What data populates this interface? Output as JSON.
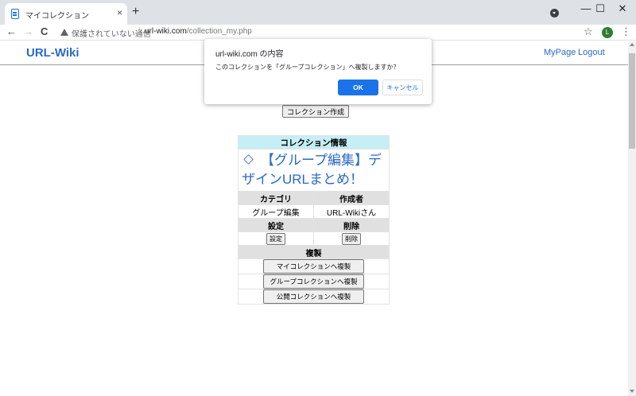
{
  "browser": {
    "tab_title": "マイコレクション",
    "tab_close": "×",
    "new_tab": "+",
    "back": "←",
    "forward": "→",
    "reload": "C",
    "security_text": "保護されていない通信",
    "url_separator": "|",
    "url_domain": "url-wiki.com",
    "url_path": "/collection_my.php",
    "star": "☆",
    "avatar_letter": "L",
    "menu": "⋮",
    "minimize": "—",
    "maximize": "☐",
    "close": "✕"
  },
  "site": {
    "brand": "URL-Wiki",
    "nav": {
      "mypage": "MyPage",
      "logout": "Logout"
    }
  },
  "main": {
    "create_button": "コレクション作成",
    "table": {
      "header": "コレクション情報",
      "title": "【グループ編集】デザインURLまとめ！",
      "col_category": "カテゴリ",
      "col_author": "作成者",
      "category": "グループ編集",
      "author": "URL-Wikiさん",
      "col_settings": "設定",
      "col_delete": "削除",
      "settings_button": "設定",
      "delete_button": "削除",
      "copy_header": "複製",
      "copy_my": "マイコレクションへ複製",
      "copy_group": "グループコレクションへ複製",
      "copy_public": "公開コレクションへ複製"
    }
  },
  "dialog": {
    "title": "url-wiki.com の内容",
    "message": "このコレクションを「グループコレクション」へ複製しますか？",
    "ok": "OK",
    "cancel": "キャンセル"
  }
}
